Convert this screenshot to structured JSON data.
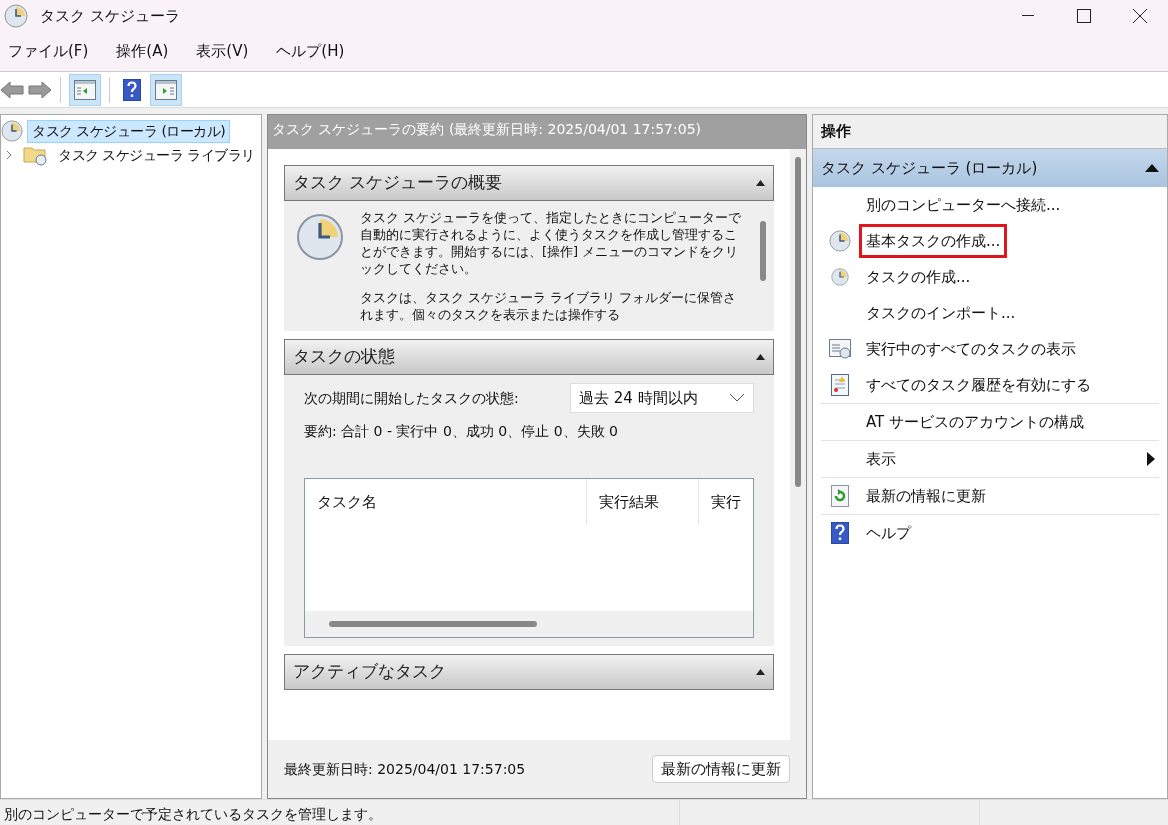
{
  "window": {
    "title": "タスク スケジューラ"
  },
  "menu": [
    "ファイル(F)",
    "操作(A)",
    "表示(V)",
    "ヘルプ(H)"
  ],
  "tree": [
    {
      "label": "タスク スケジューラ (ローカル)",
      "selected": true,
      "children": [
        {
          "label": "タスク スケジューラ ライブラリ",
          "selected": false,
          "expanded": false
        }
      ]
    }
  ],
  "summary": {
    "header": "タスク スケジューラの要約 (最終更新日時: 2025/04/01 17:57:05)",
    "sections": [
      {
        "kind": "overview",
        "title": "タスク スケジューラの概要",
        "expanded": true,
        "paragraphs": [
          "タスク スケジューラを使って、指定したときにコンピューターで自動的に実行されるように、よく使うタスクを作成し管理することができます。開始するには、[操作] メニューのコマンドをクリックしてください。",
          "タスクは、タスク スケジューラ ライブラリ フォルダーに保管されます。個々のタスクを表示または操作する"
        ]
      },
      {
        "kind": "status",
        "title": "タスクの状態",
        "expanded": true,
        "period_label": "次の期間に開始したタスクの状態:",
        "period_value": "過去 24 時間以内",
        "summary": "要約: 合計 0 - 実行中 0、成功 0、停止 0、失敗 0",
        "columns": [
          "タスク名",
          "実行結果",
          "実行"
        ]
      },
      {
        "kind": "collapsed",
        "title": "アクティブなタスク",
        "expanded": true
      }
    ],
    "footer": "最終更新日時: 2025/04/01 17:57:05",
    "refresh_button": "最新の情報に更新"
  },
  "actions": {
    "title": "操作",
    "group_title": "タスク スケジューラ (ローカル)",
    "expanded": true,
    "groups": [
      [
        {
          "label": "別のコンピューターへ接続...",
          "highlighted": false
        },
        {
          "label": "基本タスクの作成...",
          "highlighted": true
        },
        {
          "label": "タスクの作成...",
          "highlighted": false
        },
        {
          "label": "タスクのインポート...",
          "highlighted": false
        },
        {
          "label": "実行中のすべてのタスクの表示",
          "highlighted": false
        },
        {
          "label": "すべてのタスク履歴を有効にする",
          "highlighted": false
        }
      ],
      [
        {
          "label": "AT サービスのアカウントの構成",
          "highlighted": false
        }
      ],
      [
        {
          "label": "表示",
          "highlighted": false,
          "submenu": true
        }
      ],
      [
        {
          "label": "最新の情報に更新",
          "highlighted": false
        }
      ],
      [
        {
          "label": "ヘルプ",
          "highlighted": false
        }
      ]
    ]
  },
  "status_bar": "別のコンピューターで予定されているタスクを管理します。"
}
